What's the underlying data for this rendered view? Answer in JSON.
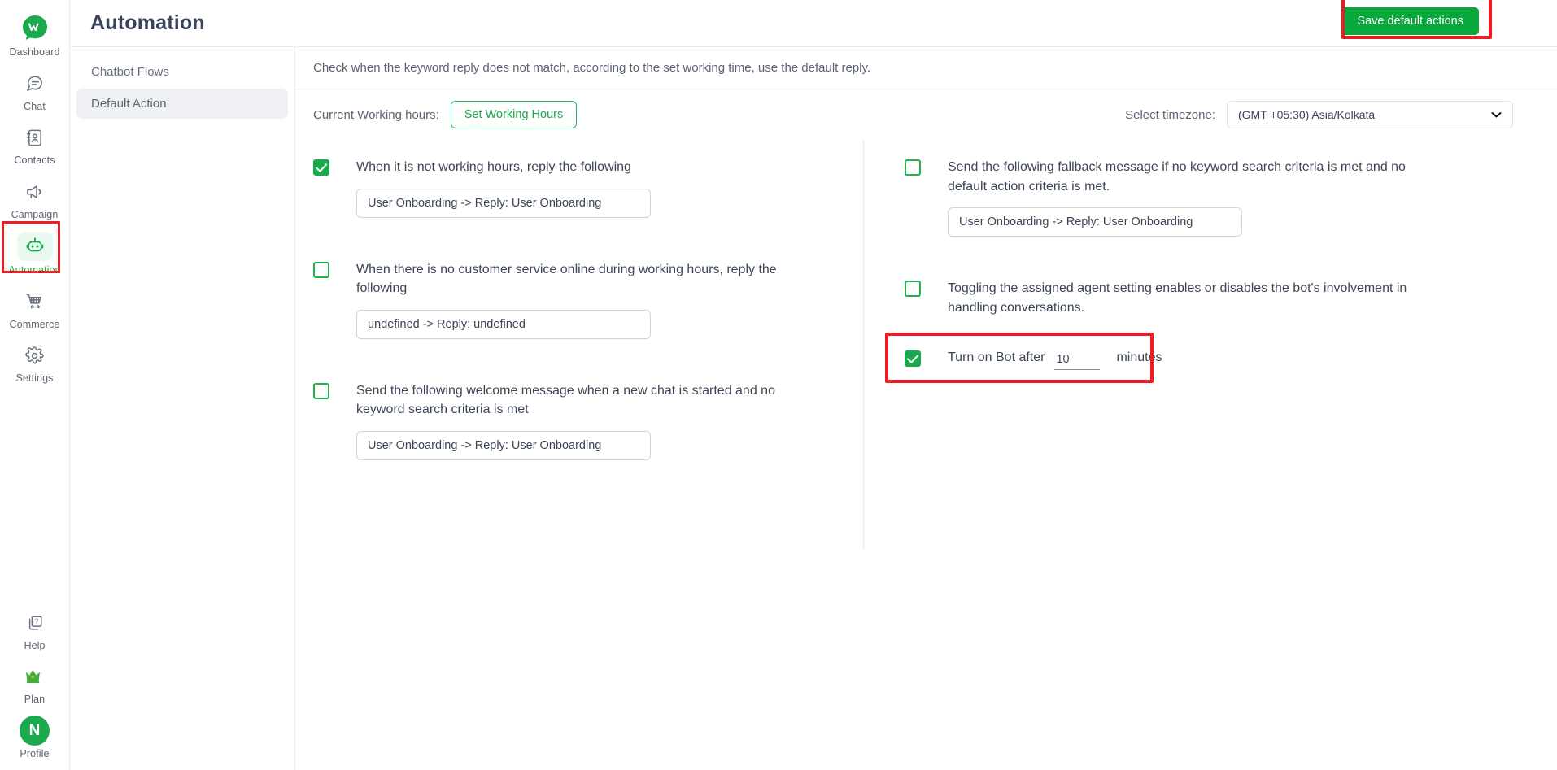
{
  "rail": {
    "logo_icon": "whatsapp-chat-logo-icon",
    "top_items": [
      {
        "label": "Dashboard",
        "icon": "chat-bubble-logo-icon",
        "active": false
      },
      {
        "label": "Chat",
        "icon": "chat-icon",
        "active": false
      },
      {
        "label": "Contacts",
        "icon": "contacts-book-icon",
        "active": false
      },
      {
        "label": "Campaign",
        "icon": "megaphone-icon",
        "active": false
      },
      {
        "label": "Automation",
        "icon": "robot-icon",
        "active": true
      },
      {
        "label": "Commerce",
        "icon": "shopping-cart-icon",
        "active": false
      },
      {
        "label": "Settings",
        "icon": "gear-icon",
        "active": false
      }
    ],
    "bottom_items": [
      {
        "label": "Help",
        "icon": "help-question-icon"
      },
      {
        "label": "Plan",
        "icon": "crown-icon"
      },
      {
        "label": "Profile",
        "icon": "avatar-icon",
        "avatar_letter": "N"
      }
    ]
  },
  "header": {
    "title": "Automation",
    "save_label": "Save default actions"
  },
  "subnav": {
    "items": [
      {
        "label": "Chatbot Flows",
        "active": false
      },
      {
        "label": "Default Action",
        "active": true
      }
    ]
  },
  "content": {
    "notice": "Check when the keyword reply does not match, according to the set working time, use the default reply.",
    "hours_label": "Current Working hours:",
    "set_hours_label": "Set Working Hours",
    "timezone_label": "Select timezone:",
    "timezone_value": "(GMT +05:30) Asia/Kolkata",
    "timezone_chevron": "chevron-down-icon"
  },
  "left_column": {
    "options": [
      {
        "checked": true,
        "text": "When it is not working hours, reply the following",
        "field_value": "User Onboarding -> Reply: User Onboarding"
      },
      {
        "checked": false,
        "text": "When there is no customer service online during working hours, reply the following",
        "field_value": "undefined -> Reply: undefined"
      },
      {
        "checked": false,
        "text": "Send the following welcome message when a new chat is started and no keyword search criteria is met",
        "field_value": "User Onboarding -> Reply: User Onboarding"
      }
    ]
  },
  "right_column": {
    "options": [
      {
        "checked": false,
        "text": "Send the following fallback message if no keyword search criteria is met and no default action criteria is met.",
        "field_value": "User Onboarding -> Reply: User Onboarding"
      },
      {
        "checked": false,
        "text": "Toggling the assigned agent setting enables or disables the bot's involvement in handling conversations.",
        "field_value": null
      }
    ],
    "bot_row": {
      "checked": true,
      "label": "Turn on Bot after",
      "minutes_value": "10",
      "minutes_suffix": "minutes"
    }
  },
  "colors": {
    "brand_green": "#1aa94c",
    "save_green": "#08a83d",
    "highlight_red": "#ee1c25",
    "text_dark": "#3c4657",
    "text_muted": "#5b6472"
  }
}
